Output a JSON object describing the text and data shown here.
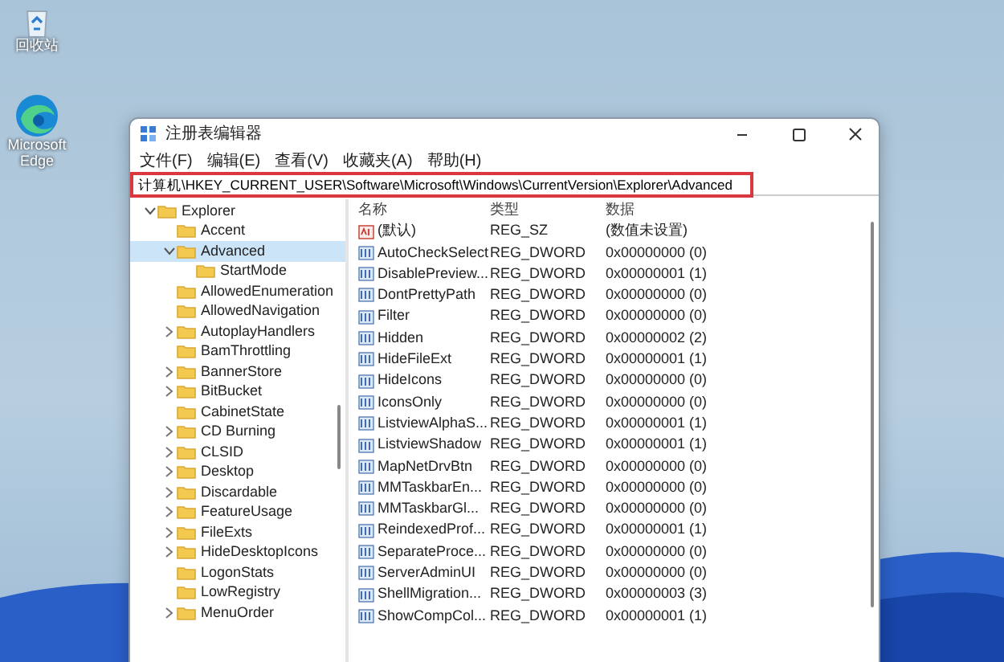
{
  "desktop_icons": [
    {
      "kind": "recycle-bin",
      "label": "回收站"
    },
    {
      "kind": "browser",
      "label": "Microsoft Edge"
    }
  ],
  "window": {
    "title": "注册表编辑器"
  },
  "menu": [
    "文件(F)",
    "编辑(E)",
    "查看(V)",
    "收藏夹(A)",
    "帮助(H)"
  ],
  "address_bar": {
    "value": "计算机\\HKEY_CURRENT_USER\\Software\\Microsoft\\Windows\\CurrentVersion\\Explorer\\Advanced",
    "highlighted": true
  },
  "tree": [
    {
      "label": "Explorer",
      "expandable": true,
      "expanded": true,
      "selected": false,
      "children": [
        {
          "label": "Accent",
          "expandable": false,
          "expanded": false,
          "selected": false
        },
        {
          "label": "Advanced",
          "expandable": true,
          "expanded": true,
          "selected": true,
          "children": [
            {
              "label": "StartMode",
              "expandable": false,
              "expanded": false,
              "selected": false
            }
          ]
        },
        {
          "label": "AllowedEnumeration",
          "expandable": false,
          "expanded": false,
          "selected": false
        },
        {
          "label": "AllowedNavigation",
          "expandable": false,
          "expanded": false,
          "selected": false
        },
        {
          "label": "AutoplayHandlers",
          "expandable": true,
          "expanded": false,
          "selected": false
        },
        {
          "label": "BamThrottling",
          "expandable": false,
          "expanded": false,
          "selected": false
        },
        {
          "label": "BannerStore",
          "expandable": true,
          "expanded": false,
          "selected": false
        },
        {
          "label": "BitBucket",
          "expandable": true,
          "expanded": false,
          "selected": false
        },
        {
          "label": "CabinetState",
          "expandable": false,
          "expanded": false,
          "selected": false
        },
        {
          "label": "CD Burning",
          "expandable": true,
          "expanded": false,
          "selected": false
        },
        {
          "label": "CLSID",
          "expandable": true,
          "expanded": false,
          "selected": false
        },
        {
          "label": "Desktop",
          "expandable": true,
          "expanded": false,
          "selected": false
        },
        {
          "label": "Discardable",
          "expandable": true,
          "expanded": false,
          "selected": false
        },
        {
          "label": "FeatureUsage",
          "expandable": true,
          "expanded": false,
          "selected": false
        },
        {
          "label": "FileExts",
          "expandable": true,
          "expanded": false,
          "selected": false
        },
        {
          "label": "HideDesktopIcons",
          "expandable": true,
          "expanded": false,
          "selected": false
        },
        {
          "label": "LogonStats",
          "expandable": false,
          "expanded": false,
          "selected": false
        },
        {
          "label": "LowRegistry",
          "expandable": false,
          "expanded": false,
          "selected": false
        },
        {
          "label": "MenuOrder",
          "expandable": true,
          "expanded": false,
          "selected": false
        }
      ]
    }
  ],
  "values_table": {
    "columns": [
      "名称",
      "类型",
      "数据"
    ],
    "rows": [
      {
        "kind": "string",
        "name": "(默认)",
        "type": "REG_SZ",
        "data": "(数值未设置)"
      },
      {
        "kind": "dword",
        "name": "AutoCheckSelect",
        "type": "REG_DWORD",
        "data": "0x00000000 (0)"
      },
      {
        "kind": "dword",
        "name": "DisablePreview...",
        "type": "REG_DWORD",
        "data": "0x00000001 (1)"
      },
      {
        "kind": "dword",
        "name": "DontPrettyPath",
        "type": "REG_DWORD",
        "data": "0x00000000 (0)"
      },
      {
        "kind": "dword",
        "name": "Filter",
        "type": "REG_DWORD",
        "data": "0x00000000 (0)"
      },
      {
        "kind": "dword",
        "name": "Hidden",
        "type": "REG_DWORD",
        "data": "0x00000002 (2)"
      },
      {
        "kind": "dword",
        "name": "HideFileExt",
        "type": "REG_DWORD",
        "data": "0x00000001 (1)"
      },
      {
        "kind": "dword",
        "name": "HideIcons",
        "type": "REG_DWORD",
        "data": "0x00000000 (0)"
      },
      {
        "kind": "dword",
        "name": "IconsOnly",
        "type": "REG_DWORD",
        "data": "0x00000000 (0)"
      },
      {
        "kind": "dword",
        "name": "ListviewAlphaS...",
        "type": "REG_DWORD",
        "data": "0x00000001 (1)"
      },
      {
        "kind": "dword",
        "name": "ListviewShadow",
        "type": "REG_DWORD",
        "data": "0x00000001 (1)"
      },
      {
        "kind": "dword",
        "name": "MapNetDrvBtn",
        "type": "REG_DWORD",
        "data": "0x00000000 (0)"
      },
      {
        "kind": "dword",
        "name": "MMTaskbarEn...",
        "type": "REG_DWORD",
        "data": "0x00000000 (0)"
      },
      {
        "kind": "dword",
        "name": "MMTaskbarGl...",
        "type": "REG_DWORD",
        "data": "0x00000000 (0)"
      },
      {
        "kind": "dword",
        "name": "ReindexedProf...",
        "type": "REG_DWORD",
        "data": "0x00000001 (1)"
      },
      {
        "kind": "dword",
        "name": "SeparateProce...",
        "type": "REG_DWORD",
        "data": "0x00000000 (0)"
      },
      {
        "kind": "dword",
        "name": "ServerAdminUI",
        "type": "REG_DWORD",
        "data": "0x00000000 (0)"
      },
      {
        "kind": "dword",
        "name": "ShellMigration...",
        "type": "REG_DWORD",
        "data": "0x00000003 (3)"
      },
      {
        "kind": "dword",
        "name": "ShowCompCol...",
        "type": "REG_DWORD",
        "data": "0x00000001 (1)"
      }
    ]
  }
}
